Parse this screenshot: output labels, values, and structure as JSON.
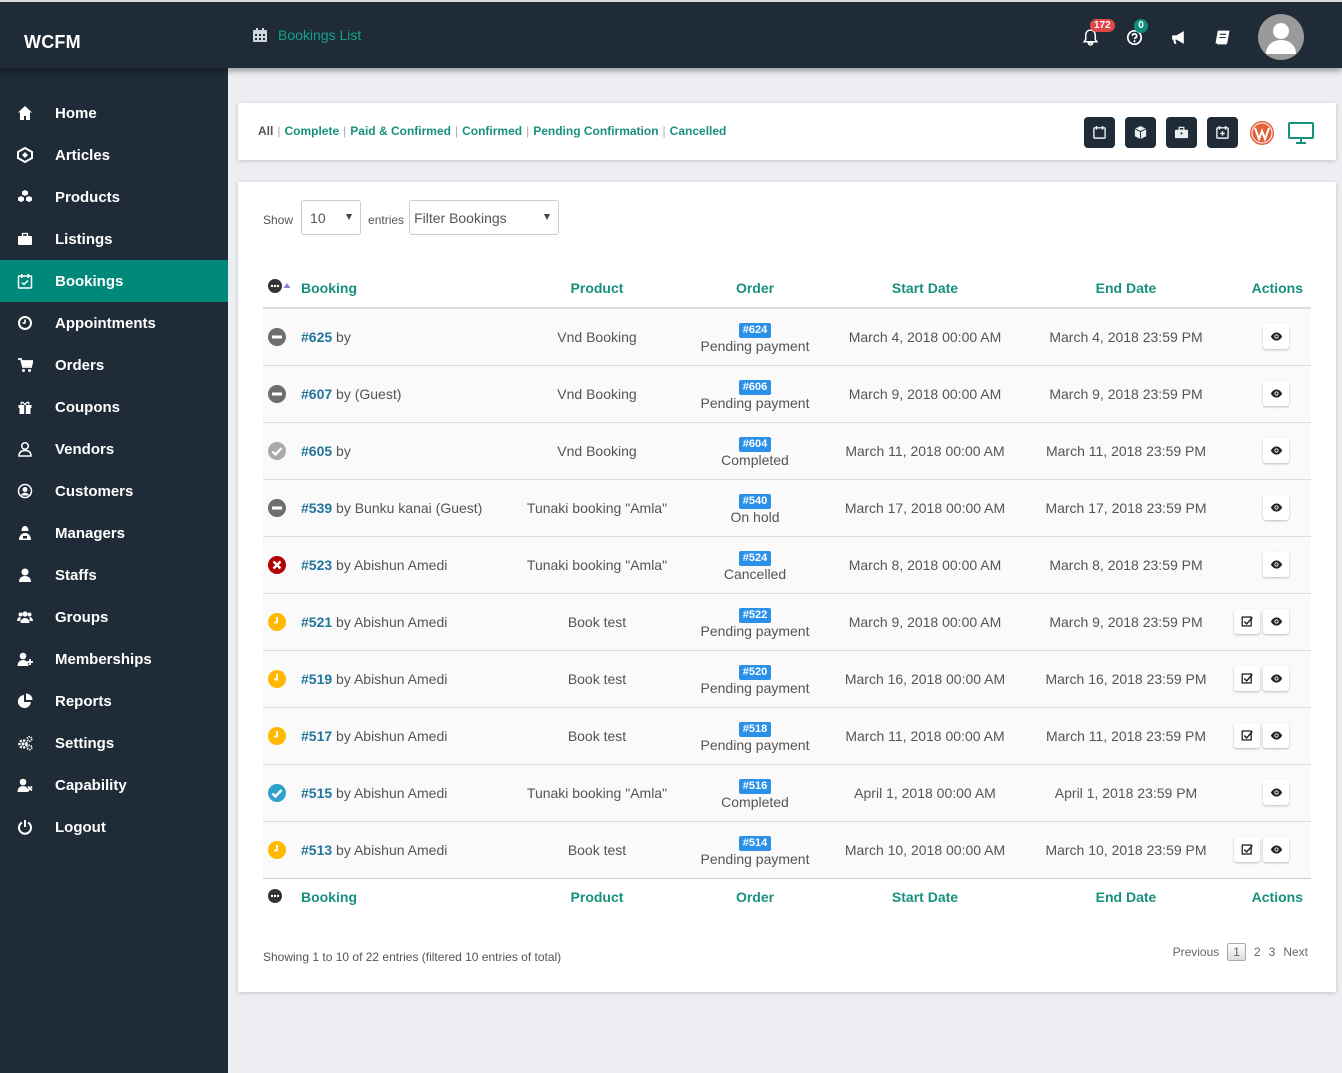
{
  "app": {
    "brand": "WCFM"
  },
  "header": {
    "breadcrumb": "Bookings List",
    "notifications_count": "172",
    "enquiries_count": "0"
  },
  "sidebar": {
    "items": [
      {
        "label": "Home",
        "icon": "home-icon"
      },
      {
        "label": "Articles",
        "icon": "articles-icon"
      },
      {
        "label": "Products",
        "icon": "cubes-icon"
      },
      {
        "label": "Listings",
        "icon": "briefcase-icon"
      },
      {
        "label": "Bookings",
        "icon": "calendar-check-icon",
        "active": true
      },
      {
        "label": "Appointments",
        "icon": "clock-icon"
      },
      {
        "label": "Orders",
        "icon": "cart-icon"
      },
      {
        "label": "Coupons",
        "icon": "gift-icon"
      },
      {
        "label": "Vendors",
        "icon": "user-outline-icon"
      },
      {
        "label": "Customers",
        "icon": "user-circle-icon"
      },
      {
        "label": "Managers",
        "icon": "manager-icon"
      },
      {
        "label": "Staffs",
        "icon": "user-icon"
      },
      {
        "label": "Groups",
        "icon": "users-icon"
      },
      {
        "label": "Memberships",
        "icon": "user-plus-icon"
      },
      {
        "label": "Reports",
        "icon": "pie-chart-icon"
      },
      {
        "label": "Settings",
        "icon": "cogs-icon"
      },
      {
        "label": "Capability",
        "icon": "user-times-icon"
      },
      {
        "label": "Logout",
        "icon": "power-icon"
      }
    ]
  },
  "status_filters": {
    "all": "All",
    "links": [
      "Complete",
      "Paid & Confirmed",
      "Confirmed",
      "Pending Confirmation",
      "Cancelled"
    ]
  },
  "toolbar": {
    "icons": [
      "calendar-icon",
      "cube-icon",
      "briefcase-icon",
      "calendar-plus-icon",
      "wordpress-icon",
      "desktop-icon"
    ]
  },
  "controls": {
    "show_label": "Show",
    "entries_value": "10",
    "entries_label": "entries",
    "filter_value": "Filter Bookings"
  },
  "table": {
    "columns": [
      "Booking",
      "Product",
      "Order",
      "Start Date",
      "End Date",
      "Actions"
    ],
    "rows": [
      {
        "status": "unpaid",
        "id": "#625",
        "by": "by",
        "product": "Vnd Booking",
        "order": "#624",
        "order_status": "Pending payment",
        "start": "March 4, 2018 00:00 AM",
        "end": "March 4, 2018 23:59 PM",
        "actions": [
          "view"
        ]
      },
      {
        "status": "unpaid",
        "id": "#607",
        "by": "by (Guest)",
        "product": "Vnd Booking",
        "order": "#606",
        "order_status": "Pending payment",
        "start": "March 9, 2018 00:00 AM",
        "end": "March 9, 2018 23:59 PM",
        "actions": [
          "view"
        ]
      },
      {
        "status": "complete",
        "id": "#605",
        "by": "by",
        "product": "Vnd Booking",
        "order": "#604",
        "order_status": "Completed",
        "start": "March 11, 2018 00:00 AM",
        "end": "March 11, 2018 23:59 PM",
        "actions": [
          "view"
        ]
      },
      {
        "status": "unpaid",
        "id": "#539",
        "by": "by Bunku kanai (Guest)",
        "product": "Tunaki booking \"Amla\"",
        "order": "#540",
        "order_status": "On hold",
        "start": "March 17, 2018 00:00 AM",
        "end": "March 17, 2018 23:59 PM",
        "actions": [
          "view"
        ]
      },
      {
        "status": "cancelled",
        "id": "#523",
        "by": "by Abishun Amedi",
        "product": "Tunaki booking \"Amla\"",
        "order": "#524",
        "order_status": "Cancelled",
        "start": "March 8, 2018 00:00 AM",
        "end": "March 8, 2018 23:59 PM",
        "actions": [
          "view"
        ]
      },
      {
        "status": "pending",
        "id": "#521",
        "by": "by Abishun Amedi",
        "product": "Book test",
        "order": "#522",
        "order_status": "Pending payment",
        "start": "March 9, 2018 00:00 AM",
        "end": "March 9, 2018 23:59 PM",
        "actions": [
          "confirm",
          "view"
        ]
      },
      {
        "status": "pending",
        "id": "#519",
        "by": "by Abishun Amedi",
        "product": "Book test",
        "order": "#520",
        "order_status": "Pending payment",
        "start": "March 16, 2018 00:00 AM",
        "end": "March 16, 2018 23:59 PM",
        "actions": [
          "confirm",
          "view"
        ]
      },
      {
        "status": "pending",
        "id": "#517",
        "by": "by Abishun Amedi",
        "product": "Book test",
        "order": "#518",
        "order_status": "Pending payment",
        "start": "March 11, 2018 00:00 AM",
        "end": "March 11, 2018 23:59 PM",
        "actions": [
          "confirm",
          "view"
        ]
      },
      {
        "status": "confirmed",
        "id": "#515",
        "by": "by Abishun Amedi",
        "product": "Tunaki booking \"Amla\"",
        "order": "#516",
        "order_status": "Completed",
        "start": "April 1, 2018 00:00 AM",
        "end": "April 1, 2018 23:59 PM",
        "actions": [
          "view"
        ]
      },
      {
        "status": "pending",
        "id": "#513",
        "by": "by Abishun Amedi",
        "product": "Book test",
        "order": "#514",
        "order_status": "Pending payment",
        "start": "March 10, 2018 00:00 AM",
        "end": "March 10, 2018 23:59 PM",
        "actions": [
          "confirm",
          "view"
        ]
      }
    ]
  },
  "footer": {
    "info": "Showing 1 to 10 of 22 entries (filtered 10 entries of total)",
    "pagination": {
      "previous": "Previous",
      "pages": [
        "1",
        "2",
        "3"
      ],
      "current": "1",
      "next": "Next"
    }
  },
  "colors": {
    "accent": "#00897b",
    "link": "#21759b",
    "dark": "#1f2b37",
    "order_tag": "#2a90e8",
    "status_pending": "#ffb900",
    "status_cancelled": "#c00000",
    "status_confirmed": "#2ea2cc",
    "status_unpaid": "#6e6e6e",
    "status_complete": "#aaaaaa"
  }
}
